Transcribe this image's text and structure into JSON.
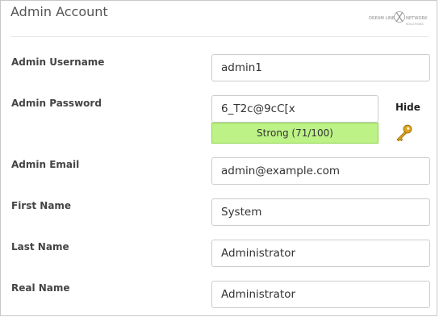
{
  "panel": {
    "title": "Admin Account",
    "logo_text_left": "DREAM LINE",
    "logo_text_right": "NETWORK",
    "logo_text_sub": "SOLUTIONS"
  },
  "form": {
    "username": {
      "label": "Admin Username",
      "value": "admin1"
    },
    "password": {
      "label": "Admin Password",
      "value": "6_T2c@9cC[x",
      "toggle_label": "Hide",
      "strength_text": "Strong (71/100)",
      "strength_score": 71,
      "strength_color": "#bdf286",
      "generate_icon": "key-icon"
    },
    "email": {
      "label": "Admin Email",
      "value": "admin@example.com"
    },
    "first_name": {
      "label": "First Name",
      "value": "System"
    },
    "last_name": {
      "label": "Last Name",
      "value": "Administrator"
    },
    "real_name": {
      "label": "Real Name",
      "value": "Administrator"
    }
  }
}
